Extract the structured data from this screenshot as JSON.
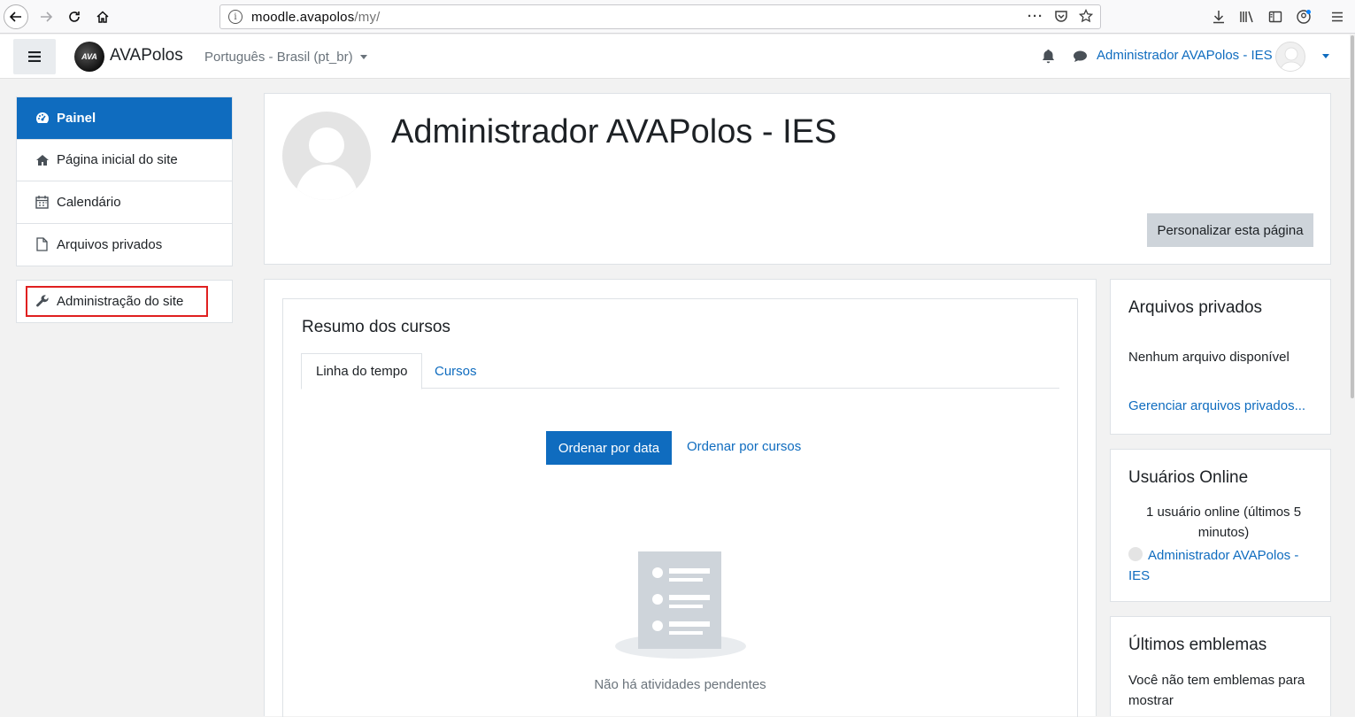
{
  "browser": {
    "url_host": "moodle.avapolos",
    "url_path": "/my/",
    "page_actions_icon": "more-dots-icon"
  },
  "navbar": {
    "site_name": "AVAPolos",
    "language": "Português - Brasil (pt_br)",
    "user_name": "Administrador AVAPolos - IES"
  },
  "sidebar": {
    "items": [
      {
        "label": "Painel",
        "icon": "dashboard-icon",
        "active": true
      },
      {
        "label": "Página inicial do site",
        "icon": "home-icon"
      },
      {
        "label": "Calendário",
        "icon": "calendar-icon"
      },
      {
        "label": "Arquivos privados",
        "icon": "file-icon"
      }
    ],
    "admin_label": "Administração do site"
  },
  "header": {
    "title": "Administrador AVAPolos - IES",
    "customize_button": "Personalizar esta página"
  },
  "course_overview": {
    "title": "Resumo dos cursos",
    "tabs": [
      "Linha do tempo",
      "Cursos"
    ],
    "sort_by_date": "Ordenar por data",
    "sort_by_courses": "Ordenar por cursos",
    "empty_message": "Não há atividades pendentes"
  },
  "blocks": {
    "private_files": {
      "title": "Arquivos privados",
      "text": "Nenhum arquivo disponível",
      "link": "Gerenciar arquivos privados..."
    },
    "online_users": {
      "title": "Usuários Online",
      "text_line1": "1 usuário online (últimos 5",
      "text_line2": "minutos)",
      "user": "Administrador AVAPolos - IES"
    },
    "badges": {
      "title": "Últimos emblemas",
      "text": "Você não tem emblemas para mostrar"
    }
  },
  "colors": {
    "primary": "#0f6cbf",
    "highlight_border": "#e02020"
  }
}
